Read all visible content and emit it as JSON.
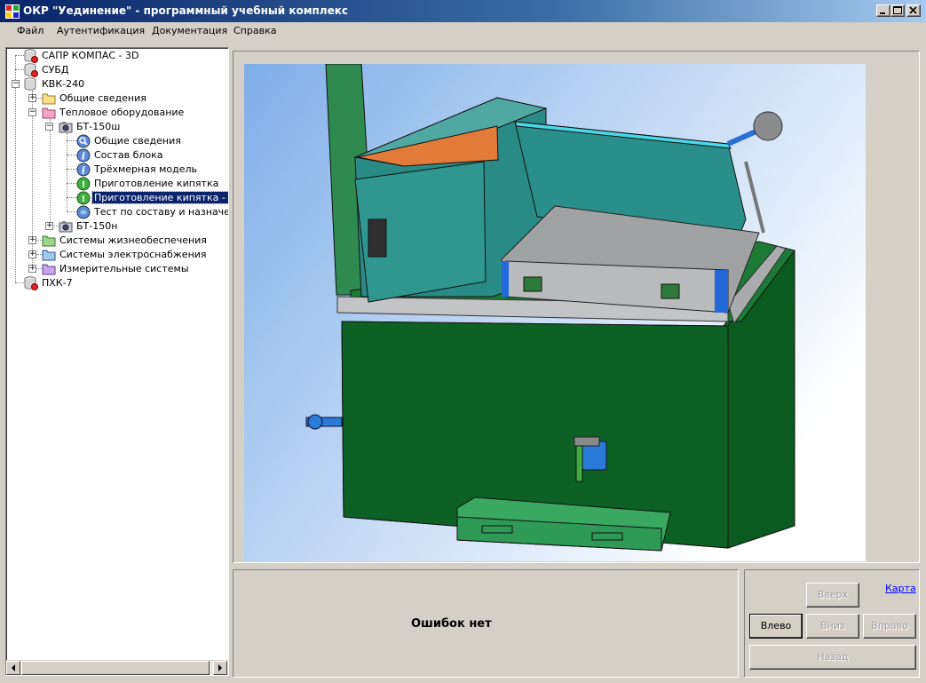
{
  "window": {
    "title": "ОКР \"Уединение\" - программный учебный комплекс"
  },
  "menu": {
    "items": [
      "Файл",
      "Аутентификация",
      "Документация",
      "Справка"
    ]
  },
  "tree": {
    "items": [
      {
        "label": "САПР КОМПАС - 3D",
        "icon": "database-red-icon"
      },
      {
        "label": "СУБД",
        "icon": "database-red-icon"
      },
      {
        "label": "КВК-240",
        "icon": "database-icon",
        "expanded": true
      },
      {
        "label": "Общие сведения",
        "icon": "folder-yellow-icon",
        "expanded": false
      },
      {
        "label": "Тепловое оборудование",
        "icon": "folder-pink-icon",
        "expanded": true
      },
      {
        "label": "БТ-150ш",
        "icon": "camera-icon",
        "expanded": true
      },
      {
        "label": "Общие сведения",
        "icon": "search-globe-icon"
      },
      {
        "label": "Состав блока",
        "icon": "info-icon"
      },
      {
        "label": "Трёхмерная модель",
        "icon": "info-icon"
      },
      {
        "label": "Приготовление кипятка",
        "icon": "green-globe-icon"
      },
      {
        "label": "Приготовление кипятка - про",
        "icon": "green-globe-icon",
        "selected": true
      },
      {
        "label": "Тест по составу и назначени",
        "icon": "test-globe-icon"
      },
      {
        "label": "БТ-150н",
        "icon": "camera-icon",
        "expanded": false
      },
      {
        "label": "Системы жизнеобеспечения",
        "icon": "folder-green-icon",
        "expanded": false
      },
      {
        "label": "Системы электроснабжения",
        "icon": "folder-blue-icon",
        "expanded": false
      },
      {
        "label": "Измерительные системы",
        "icon": "folder-violet-icon",
        "expanded": false
      },
      {
        "label": "ПХК-7",
        "icon": "database-red-icon"
      }
    ]
  },
  "status": {
    "message": "Ошибок нет"
  },
  "nav": {
    "map_link": "Карта",
    "up": "Вверх",
    "left": "Влево",
    "down": "Вниз",
    "right": "Вправо",
    "back": "Назад"
  },
  "colors": {
    "selection": "#0a246a",
    "window_face": "#d4d0c8",
    "link": "#0000ff"
  }
}
